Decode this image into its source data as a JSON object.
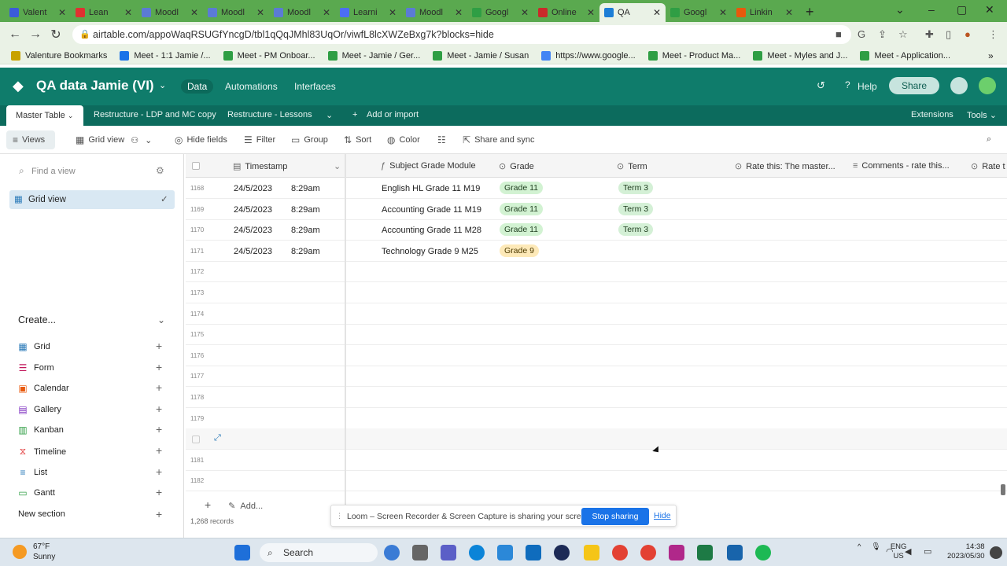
{
  "browser": {
    "tabs": [
      {
        "label": "Valent",
        "color": "#3b5bdb"
      },
      {
        "label": "Lean",
        "color": "#e03131"
      },
      {
        "label": "Moodl",
        "color": "#5b7bd5"
      },
      {
        "label": "Moodl",
        "color": "#5b7bd5"
      },
      {
        "label": "Moodl",
        "color": "#5b7bd5"
      },
      {
        "label": "Learni",
        "color": "#4c6ef5"
      },
      {
        "label": "Moodl",
        "color": "#5b7bd5"
      },
      {
        "label": "Googl",
        "color": "#2f9e44"
      },
      {
        "label": "Online",
        "color": "#c92a2a"
      },
      {
        "label": "QA",
        "color": "#1c7ed6",
        "active": true
      },
      {
        "label": "Googl",
        "color": "#2f9e44"
      },
      {
        "label": "Linkin",
        "color": "#e8590c"
      }
    ],
    "new_tab": "+",
    "url": "airtable.com/appoWaqRSUGfYncgD/tbl1qQqJMhl83UqOr/viwfL8lcXWZeBxg7k?blocks=hide",
    "bookmarks": [
      "Valenture Bookmarks",
      "Meet - 1:1 Jamie /...",
      "Meet - PM Onboar...",
      "Meet - Jamie / Ger...",
      "Meet - Jamie / Susan",
      "https://www.google...",
      "Meet - Product Ma...",
      "Meet - Myles and J...",
      "Meet - Application..."
    ]
  },
  "app": {
    "base_title": "QA data Jamie (VI)",
    "nav": [
      "Data",
      "Automations",
      "Interfaces"
    ],
    "help": "Help",
    "share": "Share",
    "table_tabs": [
      "Master Table",
      "Restructure - LDP and MC copy",
      "Restructure - Lessons"
    ],
    "add_or_import": "Add or import",
    "extensions": "Extensions",
    "tools": "Tools"
  },
  "viewbar": {
    "views": "Views",
    "grid_view": "Grid view",
    "hide_fields": "Hide fields",
    "filter": "Filter",
    "group": "Group",
    "sort": "Sort",
    "color": "Color",
    "share_sync": "Share and sync"
  },
  "sidebar": {
    "find_placeholder": "Find a view",
    "active_view": "Grid view",
    "create_label": "Create...",
    "create_items": [
      "Grid",
      "Form",
      "Calendar",
      "Gallery",
      "Kanban",
      "Timeline",
      "List",
      "Gantt"
    ],
    "new_section": "New section"
  },
  "grid": {
    "columns": [
      "Timestamp",
      "Subject Grade Module",
      "Grade",
      "Term",
      "Rate this: The master...",
      "Comments - rate this...",
      "Rate t"
    ],
    "rows": [
      {
        "num": "1168",
        "date": "24/5/2023",
        "time": "8:29am",
        "subject": "English HL Grade 11 M19",
        "grade": "Grade 11",
        "term": "Term 3"
      },
      {
        "num": "1169",
        "date": "24/5/2023",
        "time": "8:29am",
        "subject": "Accounting Grade 11 M19",
        "grade": "Grade 11",
        "term": "Term 3"
      },
      {
        "num": "1170",
        "date": "24/5/2023",
        "time": "8:29am",
        "subject": "Accounting Grade 11 M28",
        "grade": "Grade 11",
        "term": "Term 3"
      },
      {
        "num": "1171",
        "date": "24/5/2023",
        "time": "8:29am",
        "subject": "Technology Grade 9 M25",
        "grade": "Grade 9",
        "term": ""
      },
      {
        "num": "1172"
      },
      {
        "num": "1173"
      },
      {
        "num": "1174"
      },
      {
        "num": "1175"
      },
      {
        "num": "1176"
      },
      {
        "num": "1177"
      },
      {
        "num": "1178"
      },
      {
        "num": "1179"
      },
      {
        "num": ""
      },
      {
        "num": "1181"
      },
      {
        "num": "1182"
      }
    ],
    "add_label": "Add...",
    "records": "1,268 records"
  },
  "loom": {
    "message": "Loom – Screen Recorder & Screen Capture is sharing your screen.",
    "stop": "Stop sharing",
    "hide": "Hide"
  },
  "taskbar": {
    "temp": "67°F",
    "weather": "Sunny",
    "search": "Search",
    "lang1": "ENG",
    "lang2": "US",
    "time": "14:38",
    "date": "2023/05/30"
  }
}
